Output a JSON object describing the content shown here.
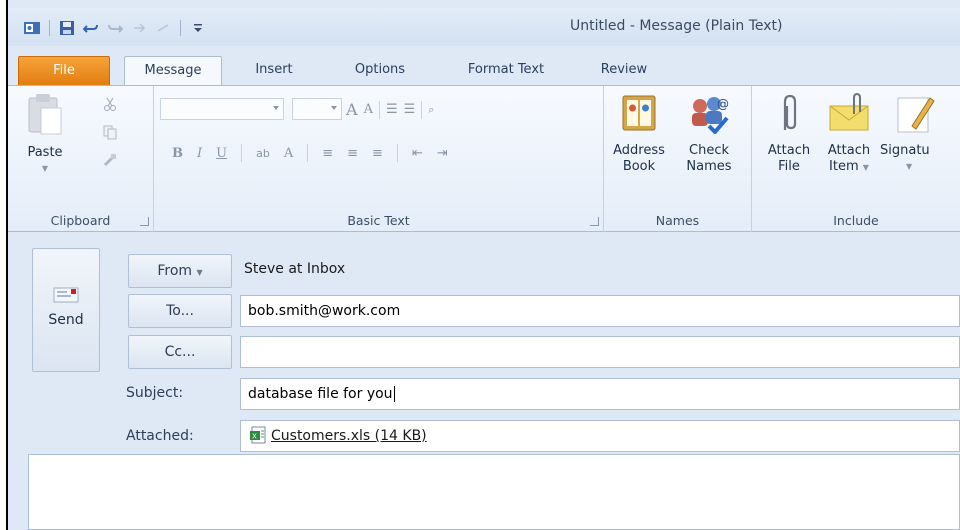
{
  "window": {
    "title": "Untitled - Message (Plain Text)"
  },
  "qat": {
    "icons": [
      "outlook-icon",
      "save-icon",
      "undo-icon",
      "redo-icon",
      "up-icon",
      "down-icon",
      "customize-icon"
    ]
  },
  "tabs": [
    {
      "label": "File",
      "state": "file"
    },
    {
      "label": "Message",
      "state": "active"
    },
    {
      "label": "Insert",
      "state": "normal"
    },
    {
      "label": "Options",
      "state": "normal"
    },
    {
      "label": "Format Text",
      "state": "normal"
    },
    {
      "label": "Review",
      "state": "normal"
    }
  ],
  "ribbon": {
    "clipboard": {
      "paste_label": "Paste",
      "group_label": "Clipboard"
    },
    "basic_text": {
      "bold": "B",
      "italic": "I",
      "underline": "U",
      "font_color": "A",
      "grow_font": "A",
      "shrink_font": "A",
      "highlight": "ab",
      "group_label": "Basic Text"
    },
    "names": {
      "address_book_line1": "Address",
      "address_book_line2": "Book",
      "check_names_line1": "Check",
      "check_names_line2": "Names",
      "group_label": "Names"
    },
    "include": {
      "attach_file_line1": "Attach",
      "attach_file_line2": "File",
      "attach_item_line1": "Attach",
      "attach_item_line2": "Item",
      "signature_label": "Signatu",
      "group_label": "Include"
    }
  },
  "message": {
    "send_label": "Send",
    "from_button": "From",
    "from_value": "Steve at Inbox",
    "to_button": "To...",
    "to_value": "bob.smith@work.com",
    "cc_button": "Cc...",
    "cc_value": "",
    "subject_label": "Subject:",
    "subject_value": "database file for you",
    "attached_label": "Attached:",
    "attachment_name": "Customers.xls (14 KB)"
  },
  "colors": {
    "file_tab": "#e07b0f",
    "ribbon_bg": "#e4edf8",
    "window_bg": "#dfe9f5",
    "accent": "#1e395b"
  }
}
